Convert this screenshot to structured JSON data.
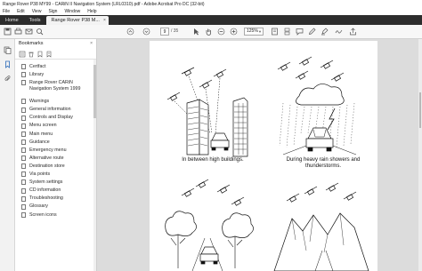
{
  "window": {
    "title": "Range Rover P38 MY99 - CARiN II Navigation System (LRL0310).pdf - Adobe Acrobat Pro DC (32-bit)"
  },
  "menu": [
    "File",
    "Edit",
    "View",
    "Sign",
    "Window",
    "Help"
  ],
  "tabs": {
    "home": "Home",
    "tools": "Tools",
    "document": "Range Rover P38 M...",
    "close": "×"
  },
  "toolbar": {
    "current_page": "9",
    "total_pages": "/ 35",
    "zoom": "125%"
  },
  "bookmarks": {
    "title": "Bookmarks",
    "close": "×",
    "items": [
      "Certfact",
      "Library",
      "Range Rover CARiN Navigation System 1999",
      "Warnings",
      "General information",
      "Controls and Display",
      "Menu screen",
      "Main menu",
      "Guidance",
      "Emergency menu",
      "Alternative route",
      "Destination store",
      "Via points",
      "System settings",
      "CD information",
      "Troubleshooting",
      "Glossary",
      "Screen icons"
    ]
  },
  "page": {
    "caption_buildings": "In between high buildings.",
    "caption_rain": "During heavy rain showers and thunderstorms."
  },
  "icons": {
    "home_icon": "home",
    "print_icon": "print",
    "search_icon": "search",
    "bookmark_icon": "bookmark"
  }
}
